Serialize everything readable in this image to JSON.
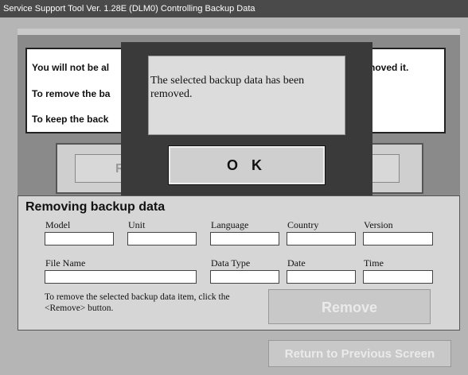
{
  "window": {
    "title": "Service Support Tool Ver. 1.28E (DLM0)   Controlling Backup Data"
  },
  "message": {
    "line1": "You will not be al",
    "line1_end": "noved it.",
    "line2": "To remove the ba",
    "line3": "To keep the back"
  },
  "background_buttons": {
    "left_partial": "R"
  },
  "section": {
    "title": "Removing backup data",
    "fields": {
      "model_label": "Model",
      "unit_label": "Unit",
      "language_label": "Language",
      "country_label": "Country",
      "version_label": "Version",
      "filename_label": "File Name",
      "datatype_label": "Data Type",
      "date_label": "Date",
      "time_label": "Time"
    },
    "hint": "To remove the selected backup data item, click the <Remove> button.",
    "remove_label": "Remove"
  },
  "return_label": "Return to Previous Screen",
  "dialog": {
    "message": "The selected backup data has been removed.",
    "ok_label": "O K"
  }
}
